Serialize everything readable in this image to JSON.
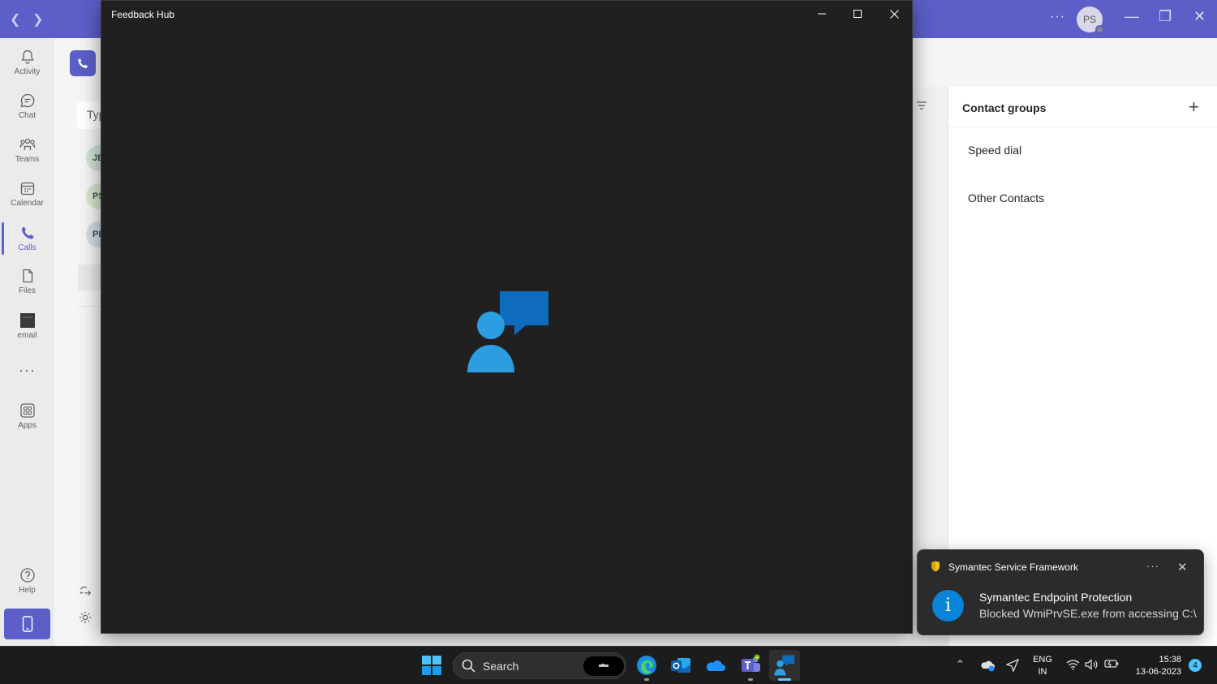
{
  "teams": {
    "rail": [
      {
        "label": "Activity",
        "icon": "bell-icon"
      },
      {
        "label": "Chat",
        "icon": "chat-icon"
      },
      {
        "label": "Teams",
        "icon": "teams-icon"
      },
      {
        "label": "Calendar",
        "icon": "calendar-icon"
      },
      {
        "label": "Calls",
        "icon": "phone-icon",
        "active": true
      },
      {
        "label": "Files",
        "icon": "file-icon"
      },
      {
        "label": "email",
        "icon": "email-app-icon"
      },
      {
        "label": "Apps",
        "icon": "apps-icon"
      },
      {
        "label": "Help",
        "icon": "help-icon"
      }
    ],
    "avatar_initials": "PS",
    "search_fragment": "Typ",
    "contact_fragments": [
      "JE",
      "PS",
      "PI"
    ],
    "contact_groups": {
      "header": "Contact groups",
      "items": [
        "Speed dial",
        "Other Contacts"
      ]
    },
    "accent": "#5b5fc7"
  },
  "feedback_hub": {
    "title": "Feedback Hub"
  },
  "toast": {
    "app": "Symantec Service Framework",
    "title": "Symantec Endpoint Protection",
    "body": "Blocked WmiPrvSE.exe from accessing C:\\"
  },
  "taskbar": {
    "search_label": "Search",
    "lang_line1": "ENG",
    "lang_line2": "IN",
    "time": "15:38",
    "date": "13-06-2023",
    "notification_count": "4"
  }
}
